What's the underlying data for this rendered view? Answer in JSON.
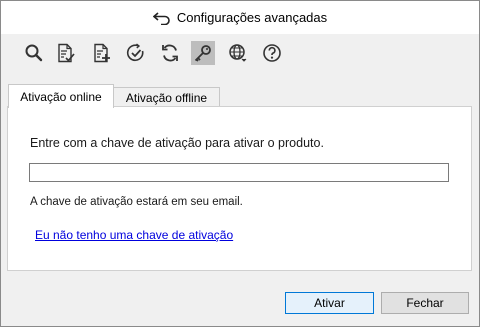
{
  "window": {
    "title": "Configurações avançadas"
  },
  "toolbar": {
    "buttons": [
      {
        "icon": "search-icon"
      },
      {
        "icon": "document-check-icon"
      },
      {
        "icon": "document-add-icon"
      },
      {
        "icon": "clock-check-icon"
      },
      {
        "icon": "refresh-icon"
      },
      {
        "icon": "key-icon",
        "active": true
      },
      {
        "icon": "globe-icon"
      },
      {
        "icon": "help-icon"
      }
    ]
  },
  "tabs": [
    {
      "label": "Ativação online",
      "active": true
    },
    {
      "label": "Ativação offline",
      "active": false
    }
  ],
  "panel": {
    "instruction": "Entre com a chave de ativação para ativar o produto.",
    "key_input_value": "",
    "hint": "A chave de ativação estará em seu email.",
    "no_key_link": "Eu não tenho uma chave de ativação"
  },
  "footer": {
    "activate_label": "Ativar",
    "close_label": "Fechar"
  },
  "colors": {
    "link": "#0000dd",
    "primary_border": "#0078d7",
    "active_tool_bg": "#bdbdbd"
  }
}
